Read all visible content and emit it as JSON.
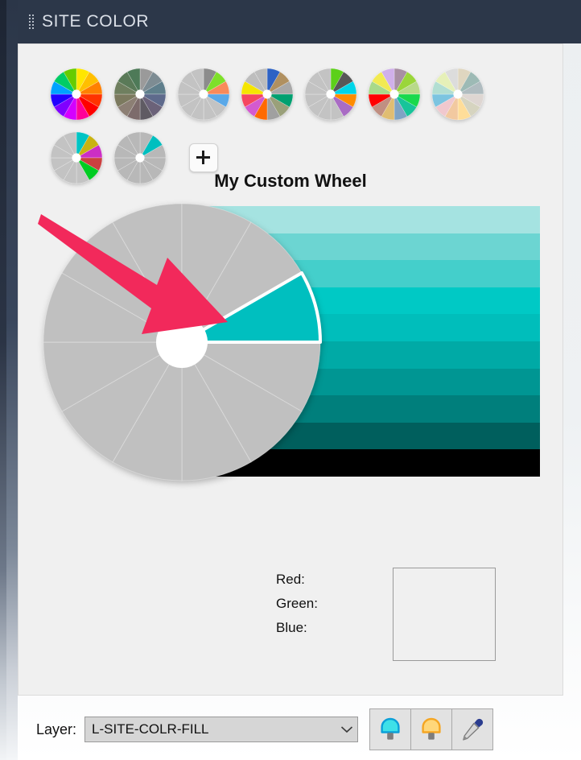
{
  "panel": {
    "title": "SITE COLOR",
    "grip_icon": "drag-grip-icon"
  },
  "presets": {
    "add_label": "+",
    "wheels": [
      {
        "name": "preset-wheel-1",
        "selected": false,
        "colors": [
          "#ffe600",
          "#ffbf00",
          "#ff8000",
          "#ff3300",
          "#ff0000",
          "#ff0099",
          "#d400ff",
          "#8000ff",
          "#2200ff",
          "#00a2ff",
          "#00cc66",
          "#66cc00"
        ]
      },
      {
        "name": "preset-wheel-2",
        "selected": false,
        "colors": [
          "#9a9a9a",
          "#7d8c93",
          "#5f7f8c",
          "#5e6a8c",
          "#6b6279",
          "#5f5b63",
          "#7d6b6b",
          "#8c7f74",
          "#7c7a5f",
          "#6f7f5f",
          "#5a7a58",
          "#4e7a58"
        ]
      },
      {
        "name": "preset-wheel-3",
        "selected": false,
        "colors": [
          "#8c8c8c",
          "#7ee02a",
          "#f98a5a",
          "#5aa8e8",
          "#c3c3c3",
          "#c3c3c3",
          "#c3c3c3",
          "#c3c3c3",
          "#c3c3c3",
          "#c3c3c3",
          "#c3c3c3",
          "#c3c3c3"
        ]
      },
      {
        "name": "preset-wheel-4",
        "selected": false,
        "colors": [
          "#2e62c4",
          "#b09060",
          "#a8a8a8",
          "#00a070",
          "#9aa07a",
          "#a0a0a0",
          "#ff6a00",
          "#d45ad0",
          "#f5465f",
          "#f5e500",
          "#bdbdbd",
          "#bdbdbd"
        ]
      },
      {
        "name": "preset-wheel-5",
        "selected": false,
        "colors": [
          "#5cd019",
          "#585858",
          "#00d5e8",
          "#ff8c00",
          "#a96cc4",
          "#c3c3c3",
          "#c3c3c3",
          "#c3c3c3",
          "#c3c3c3",
          "#c3c3c3",
          "#c3c3c3",
          "#c3c3c3"
        ]
      },
      {
        "name": "preset-wheel-6",
        "selected": false,
        "colors": [
          "#a88fa3",
          "#9ad63a",
          "#b8d98a",
          "#18d94c",
          "#18c49a",
          "#7fa3c4",
          "#e0bd72",
          "#c08f82",
          "#ff0000",
          "#a8d98a",
          "#f2ea52",
          "#d0b0ea"
        ]
      },
      {
        "name": "preset-wheel-7",
        "selected": false,
        "colors": [
          "#dfd6c0",
          "#9dbab5",
          "#b0bcc0",
          "#ded6d2",
          "#d6d4c0",
          "#ffdd99",
          "#f2c9a0",
          "#f0c8ce",
          "#7cc4e0",
          "#b2ded2",
          "#e6f0b8",
          "#dcdcdc"
        ]
      },
      {
        "name": "preset-wheel-8",
        "selected": false,
        "colors": [
          "#00c4c4",
          "#c9b312",
          "#cc2ec4",
          "#cc4040",
          "#00cc22",
          "#c3c3c3",
          "#c3c3c3",
          "#c3c3c3",
          "#c3c3c3",
          "#c3c3c3",
          "#c3c3c3",
          "#c3c3c3"
        ]
      },
      {
        "name": "preset-wheel-9-custom",
        "selected": true,
        "colors": [
          "#b8b8b8",
          "#00bfbf",
          "#b8b8b8",
          "#b8b8b8",
          "#b8b8b8",
          "#b8b8b8",
          "#b8b8b8",
          "#b8b8b8",
          "#b8b8b8",
          "#b8b8b8",
          "#b8b8b8",
          "#b8b8b8"
        ]
      }
    ]
  },
  "wheel": {
    "title": "My Custom Wheel",
    "segment_count": 12,
    "base_color": "#c0c0c0",
    "selected_segment_index": 1,
    "selected_segment_color": "#00bfbf",
    "selected_outline_color": "#ffffff",
    "hub_color": "#ffffff"
  },
  "gradient": {
    "bands": [
      "#a5e3e1",
      "#6cd5d2",
      "#44cfcb",
      "#00c9c5",
      "#00bebb",
      "#00aaa6",
      "#009693",
      "#007f7c",
      "#005f5d",
      "#000000"
    ]
  },
  "annotation": {
    "arrow_color": "#f2295b",
    "arrow_name": "pink-pointer-arrow"
  },
  "readout": {
    "red_label": "Red:",
    "red_value": "",
    "green_label": "Green:",
    "green_value": "",
    "blue_label": "Blue:",
    "blue_value": "",
    "preview_color": "#f0f0f0"
  },
  "bottom": {
    "layer_label": "Layer:",
    "layer_value": "L-SITE-COLR-FILL",
    "layer_options": [
      "L-SITE-COLR-FILL"
    ],
    "buttons": [
      {
        "name": "bulb-on-cyan-button",
        "icon": "lightbulb-cyan-icon",
        "color": "#3ee0e8"
      },
      {
        "name": "bulb-off-amber-button",
        "icon": "lightbulb-amber-icon",
        "color": "#ffc43d"
      },
      {
        "name": "eyedropper-button",
        "icon": "eyedropper-icon",
        "color": "#2b3d8f"
      }
    ]
  }
}
